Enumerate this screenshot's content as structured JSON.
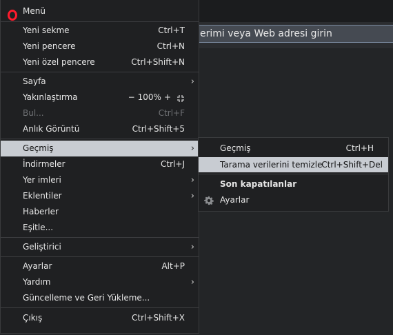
{
  "address_bar": {
    "placeholder_visible": "erimi veya Web adresi girin"
  },
  "menu": {
    "title": "Menü",
    "items": [
      {
        "label": "Yeni sekme",
        "shortcut": "Ctrl+T"
      },
      {
        "label": "Yeni pencere",
        "shortcut": "Ctrl+N"
      },
      {
        "label": "Yeni özel pencere",
        "shortcut": "Ctrl+Shift+N"
      },
      {
        "label": "Sayfa"
      },
      {
        "label": "Yakınlaştırma",
        "zoom_value": "100%",
        "zoom_minus": "−",
        "zoom_plus": "+"
      },
      {
        "label": "Bul...",
        "shortcut": "Ctrl+F"
      },
      {
        "label": "Anlık Görüntü",
        "shortcut": "Ctrl+Shift+5"
      },
      {
        "label": "Geçmiş"
      },
      {
        "label": "İndirmeler",
        "shortcut": "Ctrl+J"
      },
      {
        "label": "Yer imleri"
      },
      {
        "label": "Eklentiler"
      },
      {
        "label": "Haberler"
      },
      {
        "label": "Eşitle..."
      },
      {
        "label": "Geliştirici"
      },
      {
        "label": "Ayarlar",
        "shortcut": "Alt+P"
      },
      {
        "label": "Yardım"
      },
      {
        "label": "Güncelleme ve Geri Yükleme..."
      },
      {
        "label": "Çıkış",
        "shortcut": "Ctrl+Shift+X"
      }
    ]
  },
  "submenu": {
    "items": [
      {
        "label": "Geçmiş",
        "shortcut": "Ctrl+H"
      },
      {
        "label": "Tarama verilerini temizle",
        "shortcut": "Ctrl+Shift+Del"
      },
      {
        "label": "Son kapatılanlar"
      },
      {
        "label": "Ayarlar"
      }
    ]
  },
  "colors": {
    "accent": "#ff1b2d",
    "highlight": "#c8ccd2",
    "menu_bg": "#1f2022"
  }
}
